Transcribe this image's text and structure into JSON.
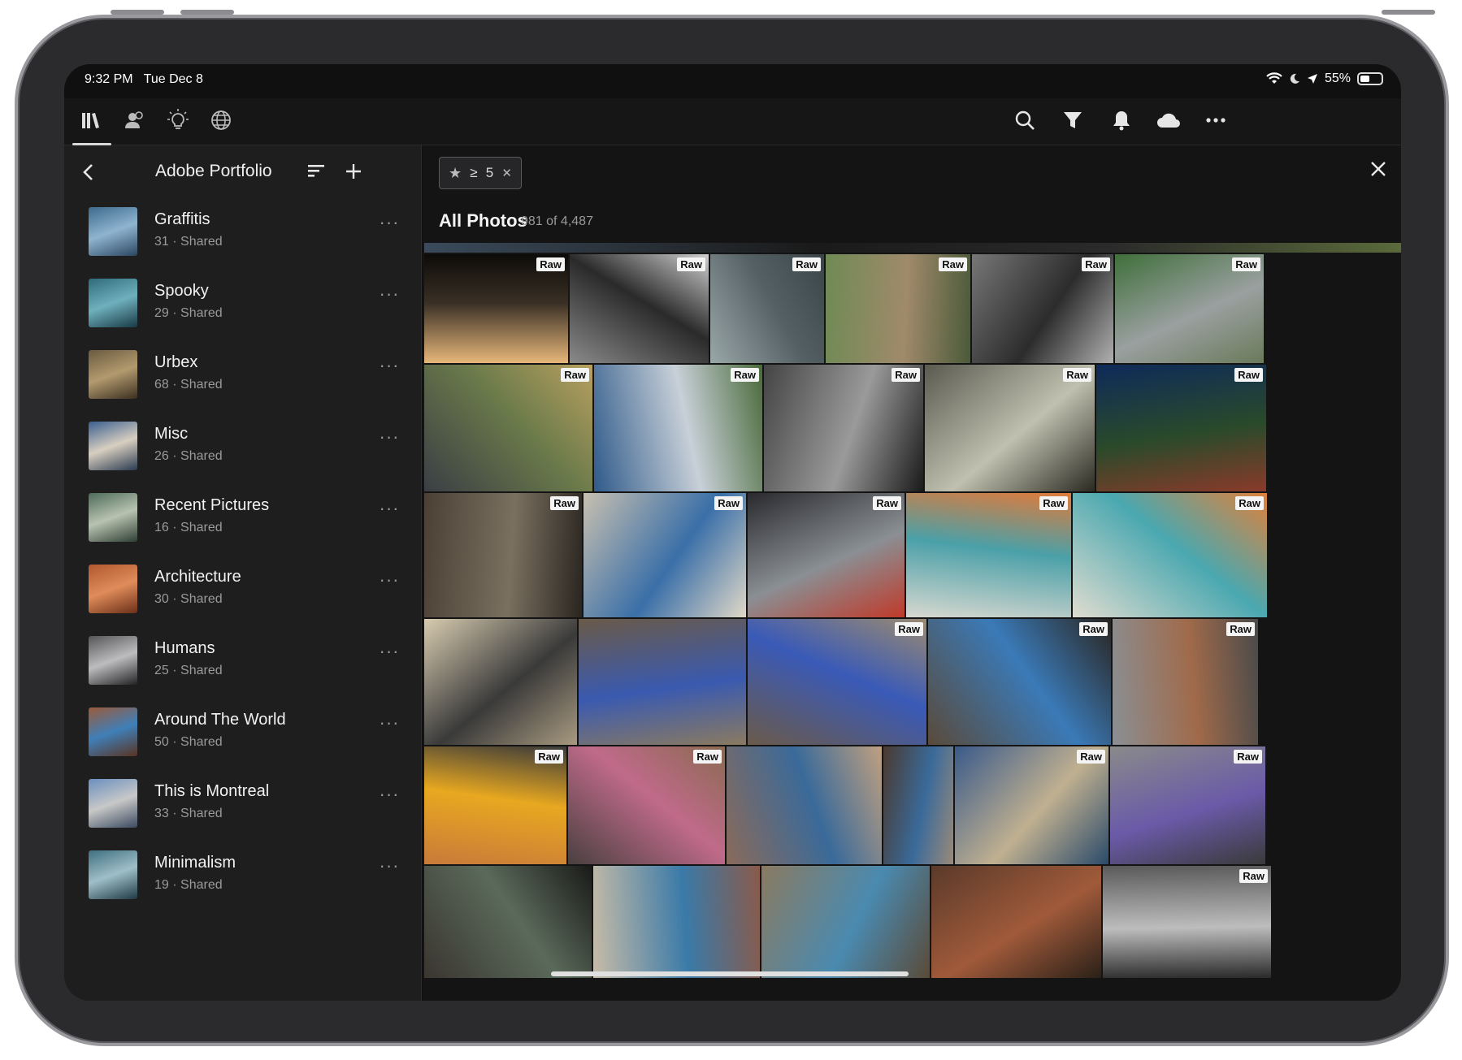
{
  "status": {
    "time": "9:32 PM",
    "date": "Tue Dec 8",
    "battery": "55%",
    "battery_level": 0.55
  },
  "topbar": {
    "left_icons": [
      "library-icon",
      "people-icon",
      "lightbulb-icon",
      "globe-icon"
    ],
    "right_icons": [
      "search-icon",
      "filter-icon",
      "bell-icon",
      "cloud-icon",
      "more-icon"
    ]
  },
  "sidebar": {
    "title": "Adobe Portfolio",
    "albums": [
      {
        "name": "Graffitis",
        "meta": "31 · Shared",
        "colors": [
          "#3c6a8c",
          "#8fb4d0",
          "#2a4660"
        ]
      },
      {
        "name": "Spooky",
        "meta": "29 · Shared",
        "colors": [
          "#2f6b7a",
          "#6fb0bd",
          "#183a44"
        ]
      },
      {
        "name": "Urbex",
        "meta": "68 · Shared",
        "colors": [
          "#6a5a3f",
          "#b39a6e",
          "#3a2f20"
        ]
      },
      {
        "name": "Misc",
        "meta": "26 · Shared",
        "colors": [
          "#3a5f8f",
          "#d8cfc0",
          "#2a3a50"
        ]
      },
      {
        "name": "Recent Pictures",
        "meta": "16 · Shared",
        "colors": [
          "#4d6b5a",
          "#b8c3b0",
          "#2f3f35"
        ]
      },
      {
        "name": "Architecture",
        "meta": "30 · Shared",
        "colors": [
          "#b0582f",
          "#e08c5a",
          "#6a2f18"
        ]
      },
      {
        "name": "Humans",
        "meta": "25 · Shared",
        "colors": [
          "#555558",
          "#bdbdc0",
          "#222224"
        ]
      },
      {
        "name": "Around The World",
        "meta": "50 · Shared",
        "colors": [
          "#9b5a3a",
          "#3f7fb8",
          "#5a3322"
        ]
      },
      {
        "name": "This is Montreal",
        "meta": "33 · Shared",
        "colors": [
          "#6a8fbf",
          "#c8c8c8",
          "#3a4a5f"
        ]
      },
      {
        "name": "Minimalism",
        "meta": "19 · Shared",
        "colors": [
          "#3f6f7f",
          "#9fbfc8",
          "#1f3a44"
        ]
      }
    ]
  },
  "filter": {
    "star": "★",
    "op": "≥",
    "value": "5",
    "clear": "✕"
  },
  "main": {
    "title": "All Photos",
    "count": "981 of 4,487",
    "raw_label": "Raw"
  },
  "rows": [
    [
      {
        "raw": true,
        "c": [
          "#e7b77a",
          "#3a3025",
          "#0d0b09"
        ]
      },
      {
        "raw": true,
        "c": [
          "#8a8a8a",
          "#2a2a2a",
          "#d0d0d0"
        ]
      },
      {
        "raw": true,
        "c": [
          "#9aa7a8",
          "#556064",
          "#3a4548"
        ]
      },
      {
        "raw": true,
        "c": [
          "#6f8a55",
          "#a08a6a",
          "#4a5a3a"
        ]
      },
      {
        "raw": true,
        "c": [
          "#777777",
          "#2c2c2c",
          "#b0b0b0"
        ]
      },
      {
        "raw": true,
        "c": [
          "#3f6f3a",
          "#9aa0a0",
          "#6a7a5a"
        ]
      }
    ],
    [
      {
        "raw": true,
        "c": [
          "#3a3e44",
          "#6a7a4a",
          "#b8a060"
        ]
      },
      {
        "raw": true,
        "c": [
          "#2f5a8a",
          "#c8d0d8",
          "#4a6a3a"
        ]
      },
      {
        "raw": true,
        "c": [
          "#444444",
          "#9a9a9a",
          "#1a1a1a"
        ]
      },
      {
        "raw": true,
        "c": [
          "#5a5a50",
          "#c0c0b0",
          "#2a2a22"
        ]
      },
      {
        "raw": true,
        "c": [
          "#0e2a5a",
          "#2a4a2a",
          "#8a3a2a"
        ]
      }
    ],
    [
      {
        "raw": true,
        "c": [
          "#4a4035",
          "#7a7060",
          "#2a2520"
        ]
      },
      {
        "raw": true,
        "c": [
          "#c8c0b0",
          "#3a6fa8",
          "#e0d8c8"
        ]
      },
      {
        "raw": true,
        "c": [
          "#2a2a2e",
          "#8a8f94",
          "#c03a2a"
        ]
      },
      {
        "raw": true,
        "c": [
          "#d8d8d0",
          "#4aa0a8",
          "#e07a3a"
        ]
      },
      {
        "raw": true,
        "c": [
          "#e0dcd0",
          "#4aa8b0",
          "#e0803a"
        ]
      }
    ],
    [
      {
        "raw": false,
        "c": [
          "#d8ccb0",
          "#3a3a3a",
          "#a89a80"
        ]
      },
      {
        "raw": false,
        "c": [
          "#6a5a48",
          "#3a5ab0",
          "#8a7a60"
        ]
      },
      {
        "raw": true,
        "c": [
          "#6a5a4a",
          "#3a5ab8",
          "#9a8a70"
        ]
      },
      {
        "raw": true,
        "c": [
          "#5a4a3a",
          "#3a7ab8",
          "#2a2520"
        ]
      },
      {
        "raw": true,
        "c": [
          "#8a8f94",
          "#a06a4a",
          "#4a4a4a"
        ]
      }
    ],
    [
      {
        "raw": true,
        "c": [
          "#c87a3a",
          "#e8a820",
          "#3a3a3a"
        ]
      },
      {
        "raw": true,
        "c": [
          "#4a4040",
          "#c06a8a",
          "#8a6a50"
        ]
      },
      {
        "raw": false,
        "c": [
          "#8a6a5a",
          "#3a6a9a",
          "#c0a080"
        ]
      },
      {
        "raw": false,
        "c": [
          "#4a3a30",
          "#3a6a9a",
          "#9a8a7a"
        ]
      },
      {
        "raw": true,
        "c": [
          "#3a5a8a",
          "#c0b090",
          "#2a4a6a"
        ]
      },
      {
        "raw": true,
        "c": [
          "#8a8a8a",
          "#6a5aa8",
          "#3a3a3a"
        ]
      }
    ],
    [
      {
        "raw": false,
        "c": [
          "#3a3530",
          "#5a6a5a",
          "#1a1a18"
        ]
      },
      {
        "raw": false,
        "c": [
          "#c8bca8",
          "#3a7aa8",
          "#8a5a4a"
        ]
      },
      {
        "raw": false,
        "c": [
          "#8a7a60",
          "#4a8ab0",
          "#5a4a38"
        ]
      },
      {
        "raw": false,
        "c": [
          "#5a3a2a",
          "#a05a3a",
          "#2a2018"
        ]
      },
      {
        "raw": true,
        "c": [
          "#5a5a5a",
          "#bdbdbd",
          "#2a2a2a"
        ]
      }
    ]
  ]
}
